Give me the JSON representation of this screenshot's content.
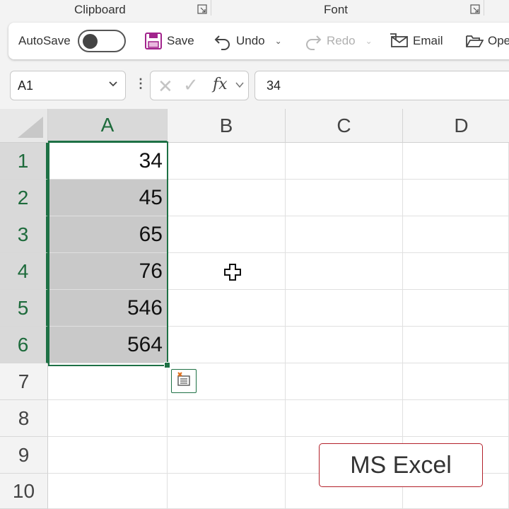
{
  "ribbon": {
    "groups": [
      {
        "label": "Clipboard"
      },
      {
        "label": "Font"
      }
    ]
  },
  "qat": {
    "autosave_label": "AutoSave",
    "autosave_on": false,
    "save_label": "Save",
    "undo_label": "Undo",
    "redo_label": "Redo",
    "email_label": "Email",
    "open_label": "Ope"
  },
  "formula_bar": {
    "name_box": "A1",
    "fx_label": "fx",
    "content": "34"
  },
  "sheet": {
    "columns": [
      "A",
      "B",
      "C",
      "D"
    ],
    "rows": [
      "1",
      "2",
      "3",
      "4",
      "5",
      "6",
      "7",
      "8",
      "9",
      "10"
    ],
    "column_a_values": [
      "34",
      "45",
      "65",
      "76",
      "546",
      "564"
    ],
    "selection": "A1:A6",
    "accent_color": "#1e7145"
  },
  "watermark": {
    "label": "MS Excel",
    "border_color": "#b3202a"
  }
}
